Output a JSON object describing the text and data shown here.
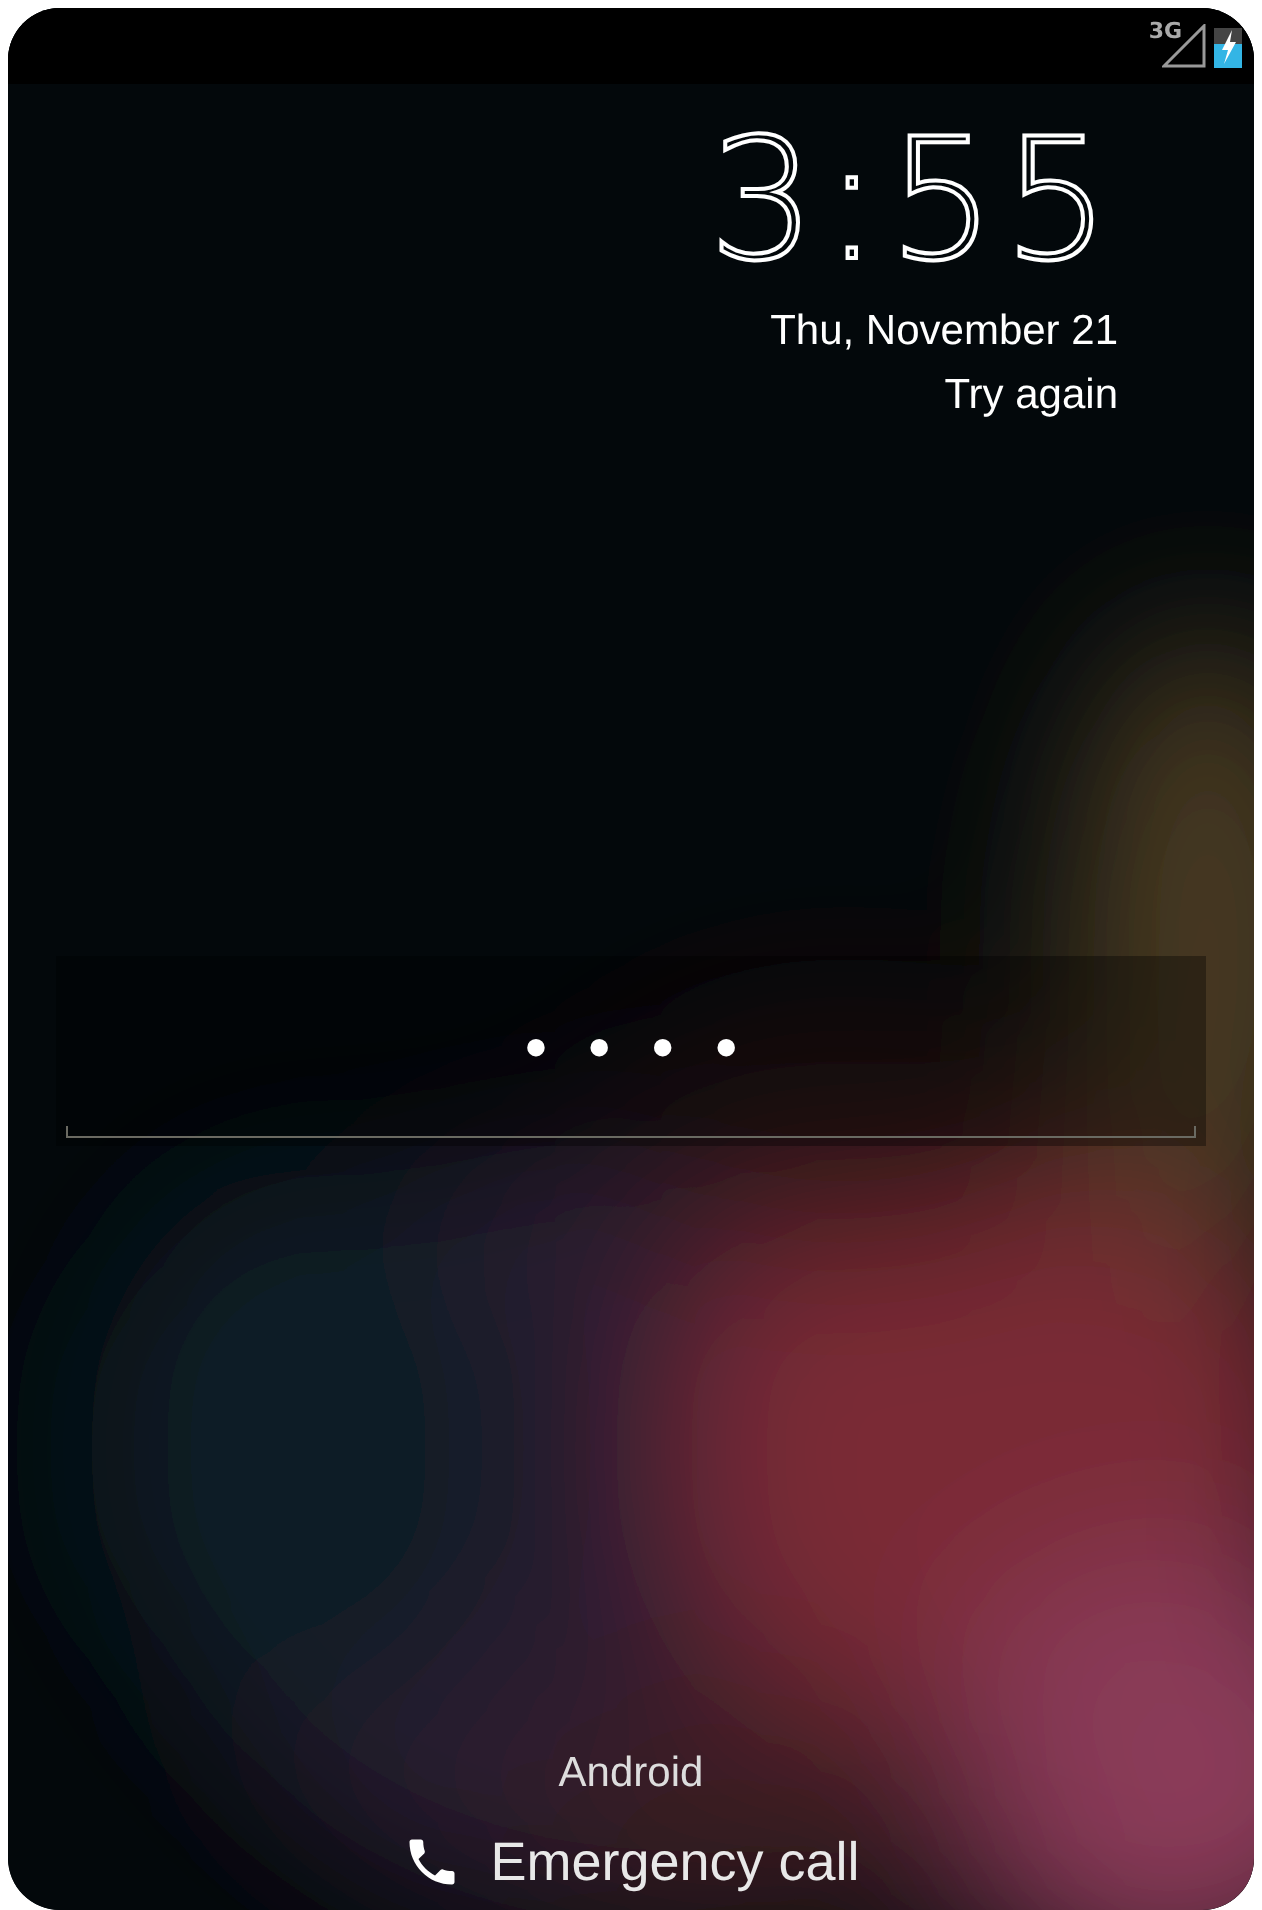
{
  "status_bar": {
    "network": "3G"
  },
  "clock": {
    "time": "3:55",
    "date": "Thu, November 21",
    "message": "Try again"
  },
  "pin_field": {
    "value": "••••"
  },
  "carrier": "Android",
  "emergency_button": {
    "label": "Emergency call"
  }
}
